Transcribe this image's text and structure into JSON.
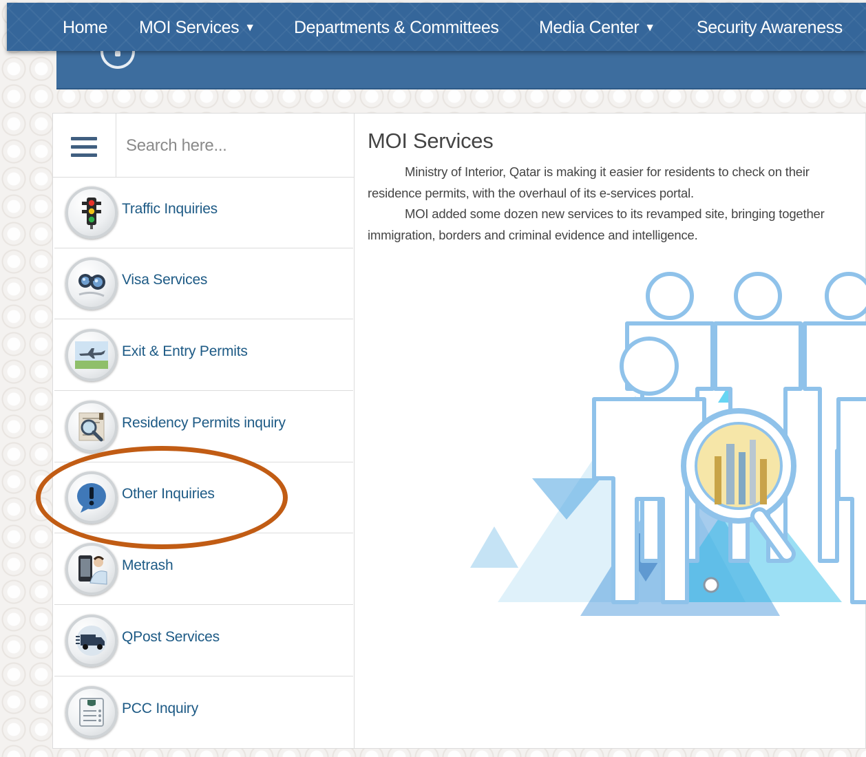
{
  "nav": {
    "items": [
      {
        "label": "Home",
        "dropdown": false
      },
      {
        "label": "MOI Services",
        "dropdown": true
      },
      {
        "label": "Departments & Committees",
        "dropdown": false
      },
      {
        "label": "Media Center",
        "dropdown": true
      },
      {
        "label": "Security Awareness",
        "dropdown": false
      }
    ],
    "caret": "▼"
  },
  "search": {
    "placeholder": "Search here..."
  },
  "sidebar": {
    "items": [
      {
        "label": "Traffic Inquiries",
        "icon": "traffic-light-icon"
      },
      {
        "label": "Visa Services",
        "icon": "binoculars-icon"
      },
      {
        "label": "Exit & Entry Permits",
        "icon": "airplane-icon"
      },
      {
        "label": "Residency Permits inquiry",
        "icon": "magnifier-document-icon"
      },
      {
        "label": "Other Inquiries",
        "icon": "exclamation-bubble-icon"
      },
      {
        "label": "Metrash",
        "icon": "phone-user-icon"
      },
      {
        "label": "QPost Services",
        "icon": "delivery-truck-icon"
      },
      {
        "label": "PCC Inquiry",
        "icon": "certificate-icon"
      }
    ]
  },
  "content": {
    "title": "MOI Services",
    "lines": [
      "Ministry of Interior, Qatar is making it easier for residents to check on their",
      "residence permits, with the overhaul of its e-services portal.",
      "MOI added some dozen new services to its revamped site, bringing together",
      "immigration, borders and criminal evidence and intelligence."
    ]
  },
  "colors": {
    "nav_bg": "#35669a",
    "link": "#1d5a85",
    "annotation": "#c15c14",
    "text": "#444444"
  }
}
